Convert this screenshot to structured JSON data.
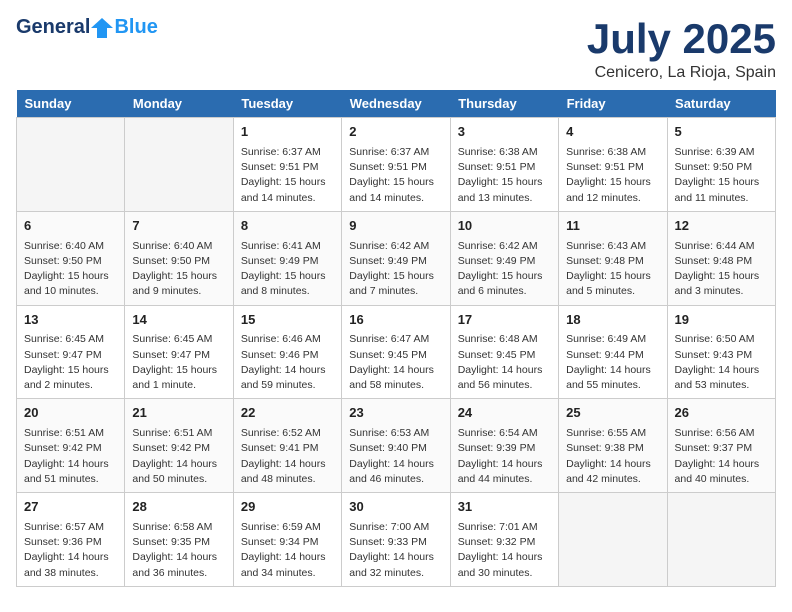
{
  "header": {
    "logo_general": "General",
    "logo_blue": "Blue",
    "month_title": "July 2025",
    "location": "Cenicero, La Rioja, Spain"
  },
  "weekdays": [
    "Sunday",
    "Monday",
    "Tuesday",
    "Wednesday",
    "Thursday",
    "Friday",
    "Saturday"
  ],
  "weeks": [
    [
      {
        "day": "",
        "info": ""
      },
      {
        "day": "",
        "info": ""
      },
      {
        "day": "1",
        "info": "Sunrise: 6:37 AM\nSunset: 9:51 PM\nDaylight: 15 hours\nand 14 minutes."
      },
      {
        "day": "2",
        "info": "Sunrise: 6:37 AM\nSunset: 9:51 PM\nDaylight: 15 hours\nand 14 minutes."
      },
      {
        "day": "3",
        "info": "Sunrise: 6:38 AM\nSunset: 9:51 PM\nDaylight: 15 hours\nand 13 minutes."
      },
      {
        "day": "4",
        "info": "Sunrise: 6:38 AM\nSunset: 9:51 PM\nDaylight: 15 hours\nand 12 minutes."
      },
      {
        "day": "5",
        "info": "Sunrise: 6:39 AM\nSunset: 9:50 PM\nDaylight: 15 hours\nand 11 minutes."
      }
    ],
    [
      {
        "day": "6",
        "info": "Sunrise: 6:40 AM\nSunset: 9:50 PM\nDaylight: 15 hours\nand 10 minutes."
      },
      {
        "day": "7",
        "info": "Sunrise: 6:40 AM\nSunset: 9:50 PM\nDaylight: 15 hours\nand 9 minutes."
      },
      {
        "day": "8",
        "info": "Sunrise: 6:41 AM\nSunset: 9:49 PM\nDaylight: 15 hours\nand 8 minutes."
      },
      {
        "day": "9",
        "info": "Sunrise: 6:42 AM\nSunset: 9:49 PM\nDaylight: 15 hours\nand 7 minutes."
      },
      {
        "day": "10",
        "info": "Sunrise: 6:42 AM\nSunset: 9:49 PM\nDaylight: 15 hours\nand 6 minutes."
      },
      {
        "day": "11",
        "info": "Sunrise: 6:43 AM\nSunset: 9:48 PM\nDaylight: 15 hours\nand 5 minutes."
      },
      {
        "day": "12",
        "info": "Sunrise: 6:44 AM\nSunset: 9:48 PM\nDaylight: 15 hours\nand 3 minutes."
      }
    ],
    [
      {
        "day": "13",
        "info": "Sunrise: 6:45 AM\nSunset: 9:47 PM\nDaylight: 15 hours\nand 2 minutes."
      },
      {
        "day": "14",
        "info": "Sunrise: 6:45 AM\nSunset: 9:47 PM\nDaylight: 15 hours\nand 1 minute."
      },
      {
        "day": "15",
        "info": "Sunrise: 6:46 AM\nSunset: 9:46 PM\nDaylight: 14 hours\nand 59 minutes."
      },
      {
        "day": "16",
        "info": "Sunrise: 6:47 AM\nSunset: 9:45 PM\nDaylight: 14 hours\nand 58 minutes."
      },
      {
        "day": "17",
        "info": "Sunrise: 6:48 AM\nSunset: 9:45 PM\nDaylight: 14 hours\nand 56 minutes."
      },
      {
        "day": "18",
        "info": "Sunrise: 6:49 AM\nSunset: 9:44 PM\nDaylight: 14 hours\nand 55 minutes."
      },
      {
        "day": "19",
        "info": "Sunrise: 6:50 AM\nSunset: 9:43 PM\nDaylight: 14 hours\nand 53 minutes."
      }
    ],
    [
      {
        "day": "20",
        "info": "Sunrise: 6:51 AM\nSunset: 9:42 PM\nDaylight: 14 hours\nand 51 minutes."
      },
      {
        "day": "21",
        "info": "Sunrise: 6:51 AM\nSunset: 9:42 PM\nDaylight: 14 hours\nand 50 minutes."
      },
      {
        "day": "22",
        "info": "Sunrise: 6:52 AM\nSunset: 9:41 PM\nDaylight: 14 hours\nand 48 minutes."
      },
      {
        "day": "23",
        "info": "Sunrise: 6:53 AM\nSunset: 9:40 PM\nDaylight: 14 hours\nand 46 minutes."
      },
      {
        "day": "24",
        "info": "Sunrise: 6:54 AM\nSunset: 9:39 PM\nDaylight: 14 hours\nand 44 minutes."
      },
      {
        "day": "25",
        "info": "Sunrise: 6:55 AM\nSunset: 9:38 PM\nDaylight: 14 hours\nand 42 minutes."
      },
      {
        "day": "26",
        "info": "Sunrise: 6:56 AM\nSunset: 9:37 PM\nDaylight: 14 hours\nand 40 minutes."
      }
    ],
    [
      {
        "day": "27",
        "info": "Sunrise: 6:57 AM\nSunset: 9:36 PM\nDaylight: 14 hours\nand 38 minutes."
      },
      {
        "day": "28",
        "info": "Sunrise: 6:58 AM\nSunset: 9:35 PM\nDaylight: 14 hours\nand 36 minutes."
      },
      {
        "day": "29",
        "info": "Sunrise: 6:59 AM\nSunset: 9:34 PM\nDaylight: 14 hours\nand 34 minutes."
      },
      {
        "day": "30",
        "info": "Sunrise: 7:00 AM\nSunset: 9:33 PM\nDaylight: 14 hours\nand 32 minutes."
      },
      {
        "day": "31",
        "info": "Sunrise: 7:01 AM\nSunset: 9:32 PM\nDaylight: 14 hours\nand 30 minutes."
      },
      {
        "day": "",
        "info": ""
      },
      {
        "day": "",
        "info": ""
      }
    ]
  ]
}
